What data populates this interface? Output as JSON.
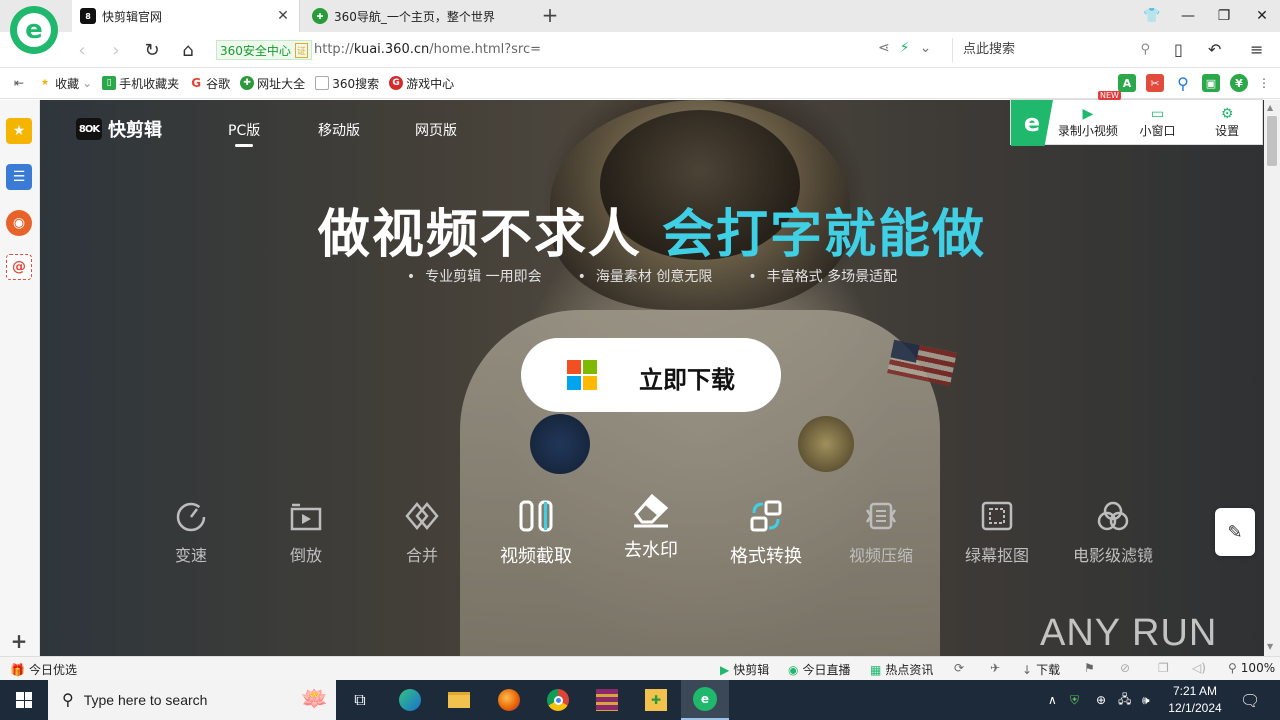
{
  "browser": {
    "tabs": [
      {
        "title": "快剪辑官网",
        "favicon": "kuaijianji-favicon",
        "active": true
      },
      {
        "title": "360导航_一个主页，整个世界",
        "favicon": "360-nav-favicon",
        "active": false
      }
    ],
    "new_tab": "+",
    "security_label": "360安全中心",
    "cert_badge": "证",
    "url_prefix": "http://",
    "url_domain": "kuai.360.cn",
    "url_path": "/home.html?src=",
    "search_placeholder": "点此搜索"
  },
  "bookmarks": [
    {
      "label": "收藏",
      "icon": "star-icon"
    },
    {
      "label": "手机收藏夹",
      "icon": "phone-icon"
    },
    {
      "label": "谷歌",
      "icon": "google-icon"
    },
    {
      "label": "网址大全",
      "icon": "360-icon"
    },
    {
      "label": "360搜索",
      "icon": "page-icon"
    },
    {
      "label": "游戏中心",
      "icon": "game-icon"
    }
  ],
  "float_panel": {
    "new_badge": "NEW",
    "items": [
      {
        "label": "录制小视频",
        "icon": "record-icon"
      },
      {
        "label": "小窗口",
        "icon": "tv-icon"
      },
      {
        "label": "设置",
        "icon": "gear-icon"
      }
    ]
  },
  "site": {
    "logo_mark": "8OK",
    "logo_text": "快剪辑",
    "nav": [
      {
        "label": "PC版",
        "active": true
      },
      {
        "label": "移动版",
        "active": false
      },
      {
        "label": "网页版",
        "active": false
      }
    ],
    "hero_title_main": "做视频不求人",
    "hero_title_accent": "会打字就能做",
    "hero_points": [
      "专业剪辑 一用即会",
      "海量素材 创意无限",
      "丰富格式 多场景适配"
    ],
    "download_label": "立即下载",
    "features": [
      {
        "label": "变速",
        "icon": "speed-icon"
      },
      {
        "label": "倒放",
        "icon": "reverse-icon"
      },
      {
        "label": "合并",
        "icon": "merge-icon"
      },
      {
        "label": "视频截取",
        "icon": "cut-icon"
      },
      {
        "label": "去水印",
        "icon": "eraser-icon"
      },
      {
        "label": "格式转换",
        "icon": "convert-icon"
      },
      {
        "label": "视频压缩",
        "icon": "compress-icon"
      },
      {
        "label": "绿幕抠图",
        "icon": "greenscreen-icon"
      },
      {
        "label": "电影级滤镜",
        "icon": "filter-icon"
      }
    ],
    "watermark": "ANY RUN"
  },
  "statusbar": {
    "left": "今日优选",
    "items": [
      "快剪辑",
      "今日直播",
      "热点资讯",
      "下载"
    ],
    "zoom": "100%"
  },
  "taskbar": {
    "search_placeholder": "Type here to search",
    "time": "7:21 AM",
    "date": "12/1/2024"
  }
}
